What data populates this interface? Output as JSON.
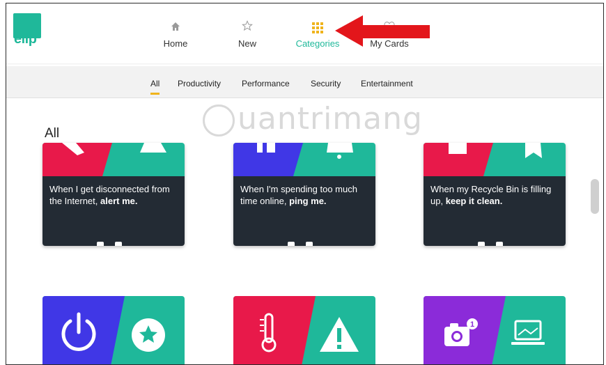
{
  "app": {
    "logo_text": "ellp",
    "accent": "#1fb89a",
    "highlight": "#f0b41c"
  },
  "nav": {
    "items": [
      {
        "label": "Home",
        "icon": "home-icon"
      },
      {
        "label": "New",
        "icon": "star-icon"
      },
      {
        "label": "Categories",
        "icon": "grid-icon",
        "active": true
      },
      {
        "label": "My Cards",
        "icon": "heart-icon"
      }
    ]
  },
  "filters": {
    "items": [
      "All",
      "Productivity",
      "Performance",
      "Security",
      "Entertainment"
    ],
    "selected": "All"
  },
  "section": {
    "title": "All"
  },
  "watermark": "uantrimang",
  "cards": [
    {
      "text_plain": "When I get disconnected from the Internet, ",
      "text_bold": "alert me.",
      "left_color": "#e8194a",
      "right_color": "#1fb89a"
    },
    {
      "text_plain": "When I'm spending too much time online, ",
      "text_bold": "ping me.",
      "left_color": "#4037e6",
      "right_color": "#1fb89a"
    },
    {
      "text_plain": "When my Recycle Bin is filling up, ",
      "text_bold": "keep it clean.",
      "left_color": "#e8194a",
      "right_color": "#1fb89a"
    }
  ],
  "cards_row2": [
    {
      "left_icon": "power-icon",
      "right_icon": "star-badge-icon",
      "left_color": "#4037e6",
      "right_color": "#1fb89a"
    },
    {
      "left_icon": "thermometer-icon",
      "right_icon": "warning-icon",
      "left_color": "#e8194a",
      "right_color": "#1fb89a"
    },
    {
      "left_icon": "camera-icon",
      "right_icon": "laptop-icon",
      "left_color": "#8b2bd9",
      "right_color": "#1fb89a"
    }
  ]
}
